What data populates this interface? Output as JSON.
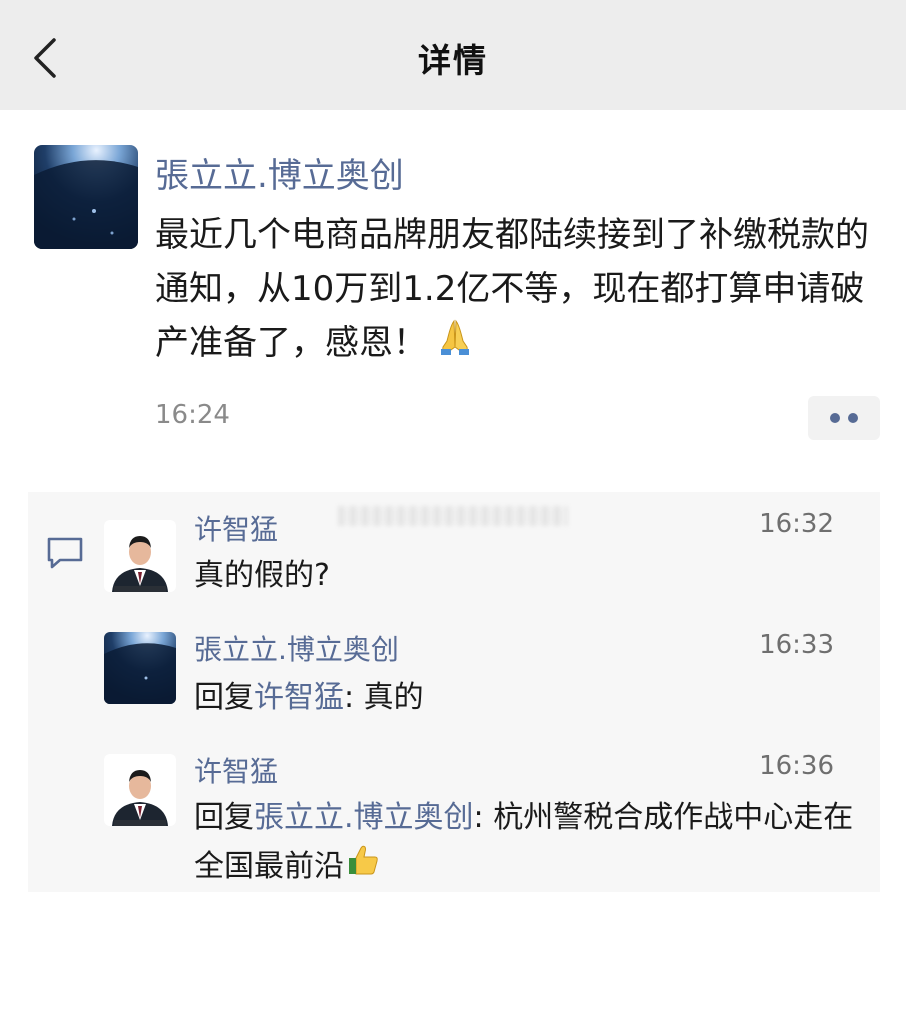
{
  "nav": {
    "title": "详情"
  },
  "post": {
    "author": "張立立.博立奥创",
    "content": "最近几个电商品牌朋友都陆续接到了补缴税款的通知，从10万到1.2亿不等，现在都打算申请破产准备了，感恩！",
    "emoji": "pray-emoji",
    "time": "16:24"
  },
  "comments": [
    {
      "author": "许智猛",
      "time": "16:32",
      "text": "真的假的?"
    },
    {
      "author": "張立立.博立奥创",
      "time": "16:33",
      "reply_prefix": "回复",
      "reply_to": "许智猛",
      "text": ": 真的"
    },
    {
      "author": "许智猛",
      "time": "16:36",
      "reply_prefix": "回复",
      "reply_to": "張立立.博立奥创",
      "text": ": 杭州警税合成作战中心走在全国最前沿"
    }
  ],
  "colors": {
    "link": "#576b95",
    "navbar": "#ededed",
    "comments_bg": "#f7f7f7"
  }
}
